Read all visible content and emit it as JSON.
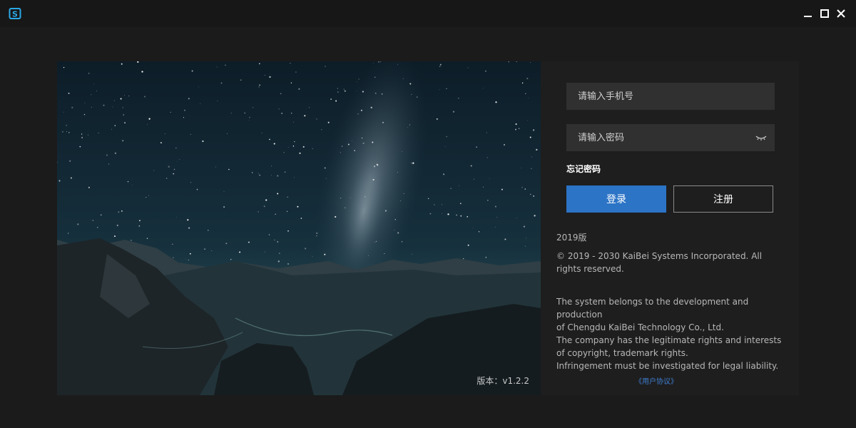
{
  "window": {
    "logo_icon": "app-s-logo",
    "controls": [
      "minimize-icon",
      "maximize-icon",
      "close-icon"
    ]
  },
  "hero": {
    "version_text": "版本：v1.2.2"
  },
  "login": {
    "phone_placeholder": "请输入手机号",
    "password_placeholder": "请输入密码",
    "password_toggle_icon": "eye-closed-icon",
    "forgot_password": "忘记密码",
    "login_button": "登录",
    "register_button": "注册"
  },
  "info": {
    "edition": "2019版",
    "copyright": "© 2019 - 2030 KaiBei Systems Incorporated. All rights reserved.",
    "legal_lines": [
      "The system belongs to the development and production",
      "of Chengdu KaiBei Technology Co., Ltd.",
      "The company has the legitimate rights and interests of copyright, trademark rights.",
      "Infringement must be investigated for legal liability."
    ],
    "user_agreement": "《用户协议》"
  },
  "colors": {
    "accent": "#2c74c6",
    "background": "#1b1b1b",
    "input_bg": "#303030",
    "link": "#3f7ed0"
  }
}
